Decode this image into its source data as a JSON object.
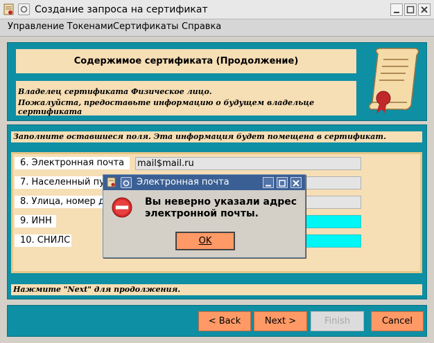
{
  "window": {
    "title": "Создание запроса на сертификат"
  },
  "menu": [
    "Управление Токенами",
    "Сертификаты",
    "Справка"
  ],
  "header": {
    "title": "Содержимое сертификата (Продолжение)",
    "owner_line1": "Владелец сертификата Физическое лицо.",
    "owner_line2": "Пожалуйста, предоставьте информацию о будущем владельце сертификата"
  },
  "instructions": "Заполните оставшиеся поля. Эта информация будет помещена в сертификат.",
  "fields": [
    {
      "label": "6. Электронная почта",
      "value": "mail$mail.ru"
    },
    {
      "label": "7. Населенный пункт",
      "value": ""
    },
    {
      "label": "8. Улица, номер дома",
      "value": ""
    },
    {
      "label": "9. ИНН",
      "value": ""
    },
    {
      "label": "10. СНИЛС",
      "value": ""
    }
  ],
  "hint": "Нажмите \"Next\" для продолжения.",
  "buttons": {
    "back": "< Back",
    "next": "Next >",
    "finish": "Finish",
    "cancel": "Cancel"
  },
  "dialog": {
    "title": "Электронная почта",
    "message_line1": "Вы неверно указали адрес",
    "message_line2": "электронной почты.",
    "ok": "OK"
  },
  "colors": {
    "teal": "#0e8fa3",
    "beige": "#f6deb5",
    "button": "#ff9966",
    "cyan_field": "#00f5f5",
    "dialog_title": "#3a5f94"
  },
  "icons": [
    "certificate-app-icon",
    "pin-icon",
    "minimize-icon",
    "maximize-icon",
    "close-icon",
    "certificate-scroll-icon",
    "error-stop-icon"
  ]
}
